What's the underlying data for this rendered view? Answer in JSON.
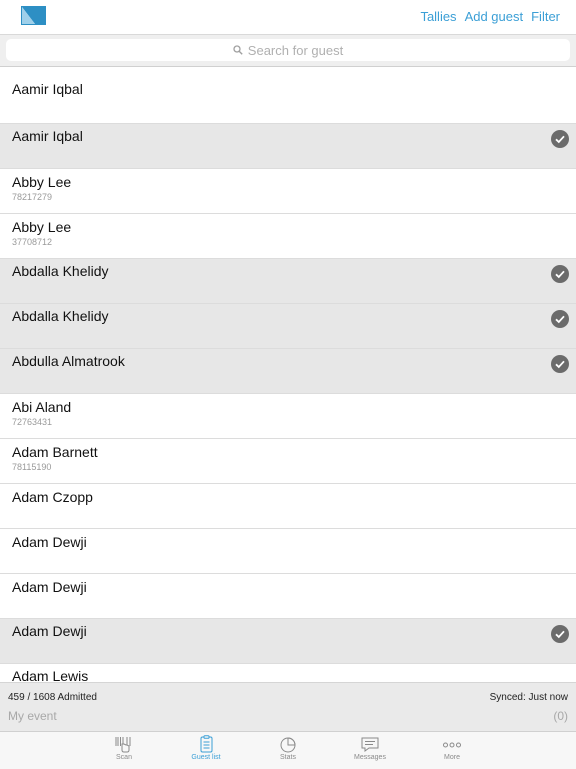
{
  "header": {
    "logo_icon": "event-logo-icon",
    "actions": {
      "tallies": "Tallies",
      "add_guest": "Add guest",
      "filter": "Filter"
    },
    "accent_color": "#3b9fd6"
  },
  "search": {
    "placeholder": "Search for guest",
    "icon": "search-icon"
  },
  "guests": [
    {
      "name": "Aamir Iqbal",
      "sub": "",
      "admitted": false
    },
    {
      "name": "Aamir Iqbal",
      "sub": "",
      "admitted": true
    },
    {
      "name": "Abby Lee",
      "sub": "78217279",
      "admitted": false
    },
    {
      "name": "Abby Lee",
      "sub": "37708712",
      "admitted": false
    },
    {
      "name": "Abdalla Khelidy",
      "sub": "",
      "admitted": true
    },
    {
      "name": "Abdalla Khelidy",
      "sub": "",
      "admitted": true
    },
    {
      "name": "Abdulla Almatrook",
      "sub": "",
      "admitted": true
    },
    {
      "name": "Abi Aland",
      "sub": "72763431",
      "admitted": false
    },
    {
      "name": "Adam Barnett",
      "sub": "78115190",
      "admitted": false
    },
    {
      "name": "Adam Czopp",
      "sub": "",
      "admitted": false
    },
    {
      "name": "Adam Dewji",
      "sub": "",
      "admitted": false
    },
    {
      "name": "Adam Dewji",
      "sub": "",
      "admitted": false
    },
    {
      "name": "Adam Dewji",
      "sub": "",
      "admitted": true
    },
    {
      "name": "Adam Lewis",
      "sub": "",
      "admitted": false
    }
  ],
  "footer": {
    "admitted_text": "459 / 1608 Admitted",
    "synced_text": "Synced: Just now",
    "event_name": "My event",
    "event_count": "(0)"
  },
  "tabs": [
    {
      "label": "Scan",
      "icon": "barcode-scan-icon",
      "active": false
    },
    {
      "label": "Guest list",
      "icon": "clipboard-list-icon",
      "active": true
    },
    {
      "label": "Stats",
      "icon": "pie-chart-icon",
      "active": false
    },
    {
      "label": "Messages",
      "icon": "message-bubble-icon",
      "active": false
    },
    {
      "label": "More",
      "icon": "more-dots-icon",
      "active": false
    }
  ]
}
